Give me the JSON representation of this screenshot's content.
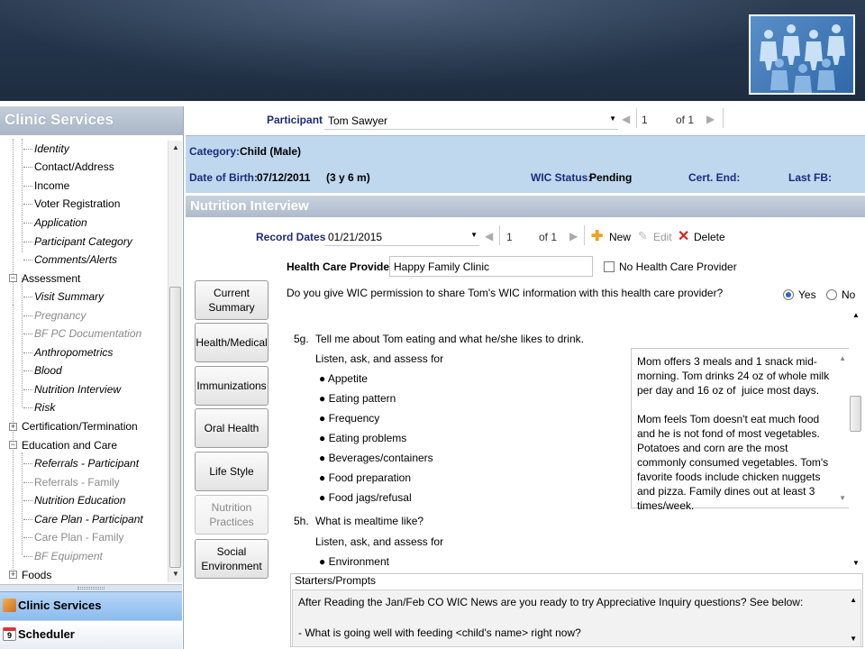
{
  "colors": {
    "selected": "#2f63c9",
    "label_navy": "#1f2a7a",
    "info_band": "#bfd8ee",
    "delete_red": "#d9261c",
    "new_orange": "#f0a020"
  },
  "nav": {
    "header": "Clinic Services",
    "items": [
      {
        "label": "Identity",
        "style": "italic"
      },
      {
        "label": "Contact/Address",
        "style": "normal"
      },
      {
        "label": "Income",
        "style": "normal"
      },
      {
        "label": "Voter Registration",
        "style": "normal"
      },
      {
        "label": "Application",
        "style": "italic"
      },
      {
        "label": "Participant Category",
        "style": "italic"
      },
      {
        "label": "Comments/Alerts",
        "style": "italic"
      },
      {
        "label": "Assessment",
        "style": "group"
      },
      {
        "label": "Visit Summary",
        "style": "italic"
      },
      {
        "label": "Pregnancy",
        "style": "gray"
      },
      {
        "label": "BF PC Documentation",
        "style": "gray"
      },
      {
        "label": "Anthropometrics",
        "style": "italic"
      },
      {
        "label": "Blood",
        "style": "italic"
      },
      {
        "label": "Nutrition Interview",
        "style": "selected"
      },
      {
        "label": "Risk",
        "style": "italic"
      },
      {
        "label": "Certification/Termination",
        "style": "group"
      },
      {
        "label": "Education and Care",
        "style": "group"
      },
      {
        "label": "Referrals - Participant",
        "style": "italic"
      },
      {
        "label": "Referrals - Family",
        "style": "gray"
      },
      {
        "label": "Nutrition Education",
        "style": "italic"
      },
      {
        "label": "Care Plan - Participant",
        "style": "italic"
      },
      {
        "label": "Care Plan - Family",
        "style": "gray"
      },
      {
        "label": "BF Equipment",
        "style": "gray"
      },
      {
        "label": "Foods",
        "style": "group"
      }
    ],
    "bottom_buttons": {
      "clinic": "Clinic Services",
      "scheduler": "Scheduler"
    }
  },
  "participant": {
    "label": "Participant",
    "value": "Tom Sawyer",
    "page": "1",
    "of": "of 1"
  },
  "info": {
    "category_label": "Category:",
    "category_value": "Child (Male)",
    "dob_label": "Date of Birth:",
    "dob_value": "07/12/2011",
    "age": "(3 y 6 m)",
    "wic_status_label": "WIC Status:",
    "wic_status_value": "Pending",
    "cert_end_label": "Cert. End:",
    "last_fb_label": "Last FB:"
  },
  "section": {
    "title": "Nutrition Interview"
  },
  "record": {
    "label": "Record Dates",
    "value": "01/21/2015",
    "page": "1",
    "of": "of 1",
    "new": "New",
    "edit": "Edit",
    "delete": "Delete"
  },
  "side_buttons": [
    {
      "label": "Current Summary",
      "enabled": true
    },
    {
      "label": "Health/Medical",
      "enabled": true
    },
    {
      "label": "Immunizations",
      "enabled": true
    },
    {
      "label": "Oral Health",
      "enabled": true
    },
    {
      "label": "Life Style",
      "enabled": true
    },
    {
      "label": "Nutrition Practices",
      "enabled": false
    },
    {
      "label": "Social Environment",
      "enabled": true
    }
  ],
  "provider": {
    "label": "Health Care Provider",
    "value": "Happy Family Clinic",
    "no_provider": "No Health Care Provider",
    "permission_question": "Do you give WIC permission to share Tom's WIC information with this health care provider?",
    "yes": "Yes",
    "no": "No",
    "selected": "Yes"
  },
  "questions": {
    "q5g": {
      "number": "5g.",
      "text": "Tell me about Tom eating and what he/she likes to drink.",
      "sub": "Listen, ask, and assess for",
      "bullets": [
        "Appetite",
        "Eating pattern",
        "Frequency",
        "Eating problems",
        "Beverages/containers",
        "Food preparation",
        "Food jags/refusal"
      ]
    },
    "q5h": {
      "number": "5h.",
      "text": "What is mealtime like?",
      "sub": "Listen, ask, and assess for",
      "bullets": [
        "Environment"
      ]
    },
    "note": "Mom offers 3 meals and 1 snack mid-morning. Tom drinks 24 oz of whole milk per day and 16 oz of  juice most days.\n\nMom feels Tom doesn't eat much food and he is not fond of most vegetables. Potatoes and corn are the most commonly consumed vegetables. Tom's favorite foods include chicken nuggets and pizza. Family dines out at least 3 times/week."
  },
  "starters": {
    "legend": "Starters/Prompts",
    "line1": "After Reading the Jan/Feb CO WIC News are you ready to try Appreciative Inquiry questions? See below:",
    "line2": "- What is going well with feeding <child's name> right now?"
  }
}
